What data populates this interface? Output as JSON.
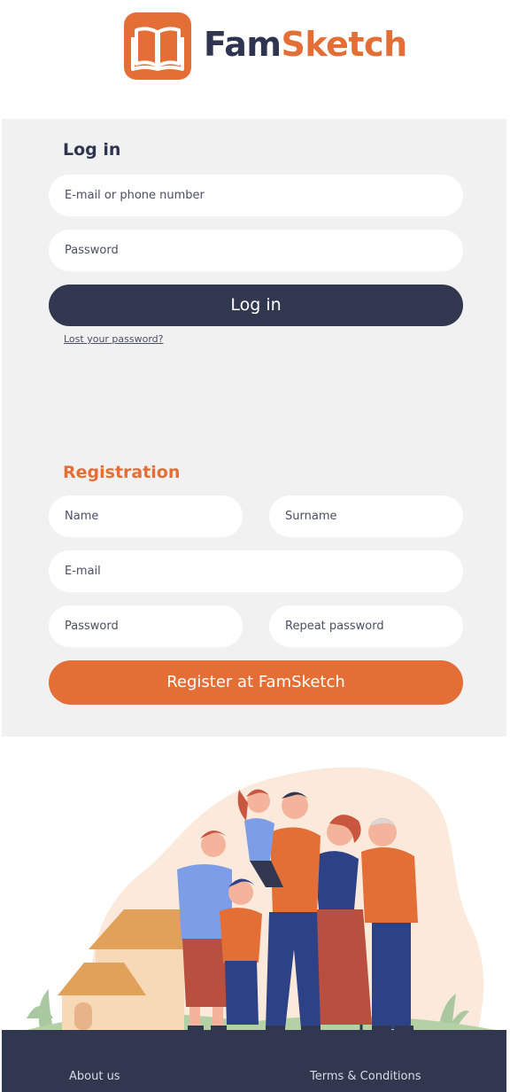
{
  "brand": {
    "name_part1": "Fam",
    "name_part2": "Sketch",
    "logo_icon": "open-book-icon",
    "colors": {
      "navy": "#31374f",
      "orange": "#e36f36",
      "panel_bg": "#f1f1f1"
    }
  },
  "login": {
    "title": "Log in",
    "email_placeholder": "E-mail or phone number",
    "password_placeholder": "Password",
    "button_label": "Log in",
    "lost_password_link": "Lost your password?"
  },
  "registration": {
    "title": "Registration",
    "name_placeholder": "Name",
    "surname_placeholder": "Surname",
    "email_placeholder": "E-mail",
    "password_placeholder": "Password",
    "repeat_password_placeholder": "Repeat password",
    "button_label": "Register at FamSketch"
  },
  "footer": {
    "about_link": "About us",
    "terms_link": "Terms & Conditions"
  }
}
